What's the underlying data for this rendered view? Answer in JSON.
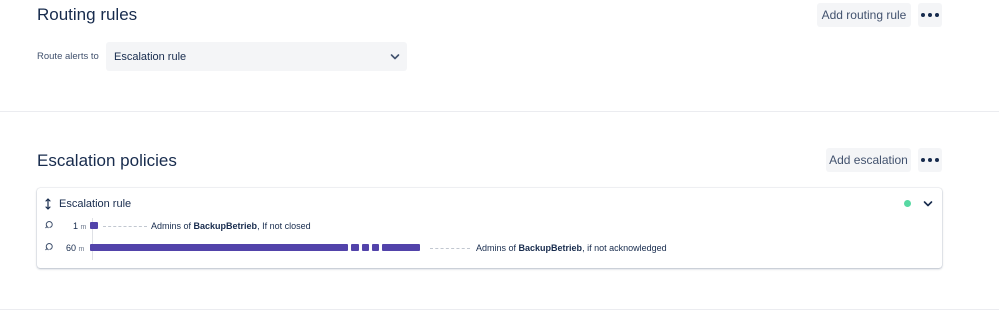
{
  "routing": {
    "title": "Routing rules",
    "add_button": "Add routing rule",
    "route_label": "Route alerts to",
    "route_value": "Escalation rule"
  },
  "escalation": {
    "title": "Escalation policies",
    "add_button": "Add escalation",
    "rule": {
      "name": "Escalation rule",
      "status_color": "#57D9A3",
      "steps": [
        {
          "time": "1",
          "unit": "m",
          "text_prefix": "Admins of ",
          "team": "BackupBetrieb",
          "condition": ", If not closed"
        },
        {
          "time": "60",
          "unit": "m",
          "text_prefix": "Admins of ",
          "team": "BackupBetrieb",
          "condition": ", if not acknowledged"
        }
      ]
    }
  },
  "colors": {
    "accent": "#5243AA",
    "status": "#57D9A3"
  }
}
